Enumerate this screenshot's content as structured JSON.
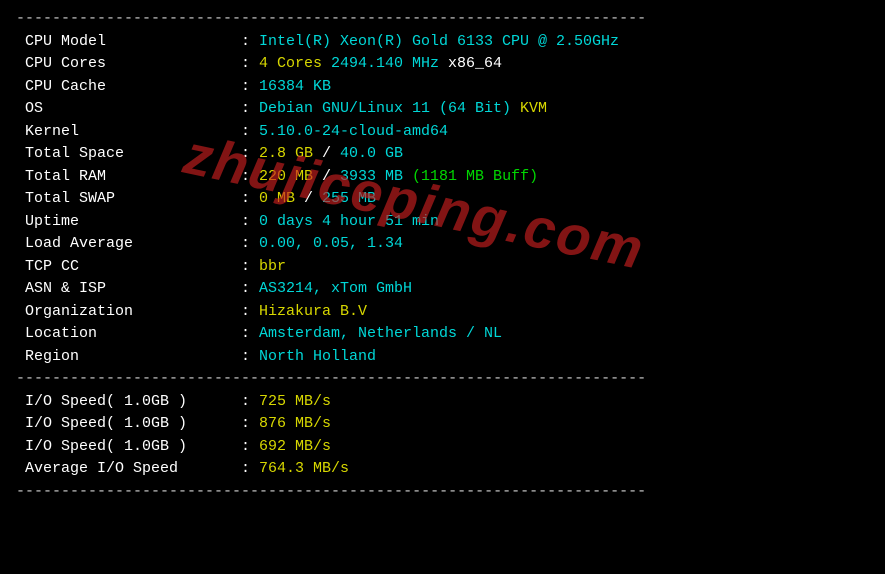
{
  "divider": "----------------------------------------------------------------------",
  "watermark": "zhujiceping.com",
  "rows": [
    {
      "label": "CPU Model",
      "parts": [
        {
          "text": "Intel(R) Xeon(R) Gold 6133 CPU @ 2.50GHz",
          "cls": "cyan"
        }
      ]
    },
    {
      "label": "CPU Cores",
      "parts": [
        {
          "text": "4 Cores",
          "cls": "yellow"
        },
        {
          "text": " 2494.140 MHz ",
          "cls": "cyan"
        },
        {
          "text": "x86_64",
          "cls": "white"
        }
      ]
    },
    {
      "label": "CPU Cache",
      "parts": [
        {
          "text": "16384 KB",
          "cls": "cyan"
        }
      ]
    },
    {
      "label": "OS",
      "parts": [
        {
          "text": "Debian GNU/Linux 11 (64 Bit) ",
          "cls": "cyan"
        },
        {
          "text": "KVM",
          "cls": "yellow"
        }
      ]
    },
    {
      "label": "Kernel",
      "parts": [
        {
          "text": "5.10.0-24-cloud-amd64",
          "cls": "cyan"
        }
      ]
    },
    {
      "label": "Total Space",
      "parts": [
        {
          "text": "2.8 GB",
          "cls": "yellow"
        },
        {
          "text": " / ",
          "cls": "white"
        },
        {
          "text": "40.0 GB",
          "cls": "cyan"
        }
      ]
    },
    {
      "label": "Total RAM",
      "parts": [
        {
          "text": "220 MB",
          "cls": "yellow"
        },
        {
          "text": " / ",
          "cls": "white"
        },
        {
          "text": "3933 MB",
          "cls": "cyan"
        },
        {
          "text": " (1181 MB Buff)",
          "cls": "green"
        }
      ]
    },
    {
      "label": "Total SWAP",
      "parts": [
        {
          "text": "0 MB",
          "cls": "yellow"
        },
        {
          "text": " / ",
          "cls": "white"
        },
        {
          "text": "255 MB",
          "cls": "cyan"
        }
      ]
    },
    {
      "label": "Uptime",
      "parts": [
        {
          "text": "0 days 4 hour 51 min",
          "cls": "cyan"
        }
      ]
    },
    {
      "label": "Load Average",
      "parts": [
        {
          "text": "0.00, 0.05, 1.34",
          "cls": "cyan"
        }
      ]
    },
    {
      "label": "TCP CC",
      "parts": [
        {
          "text": "bbr",
          "cls": "yellow"
        }
      ]
    },
    {
      "label": "ASN & ISP",
      "parts": [
        {
          "text": "AS3214, xTom GmbH",
          "cls": "cyan"
        }
      ]
    },
    {
      "label": "Organization",
      "parts": [
        {
          "text": "Hizakura B.V",
          "cls": "yellow"
        }
      ]
    },
    {
      "label": "Location",
      "parts": [
        {
          "text": "Amsterdam, Netherlands / NL",
          "cls": "cyan"
        }
      ]
    },
    {
      "label": "Region",
      "parts": [
        {
          "text": "North Holland",
          "cls": "cyan"
        }
      ]
    }
  ],
  "io_rows": [
    {
      "label": "I/O Speed( 1.0GB )",
      "parts": [
        {
          "text": "725 MB/s",
          "cls": "yellow"
        }
      ]
    },
    {
      "label": "I/O Speed( 1.0GB )",
      "parts": [
        {
          "text": "876 MB/s",
          "cls": "yellow"
        }
      ]
    },
    {
      "label": "I/O Speed( 1.0GB )",
      "parts": [
        {
          "text": "692 MB/s",
          "cls": "yellow"
        }
      ]
    },
    {
      "label": "Average I/O Speed",
      "parts": [
        {
          "text": "764.3 MB/s",
          "cls": "yellow"
        }
      ]
    }
  ]
}
